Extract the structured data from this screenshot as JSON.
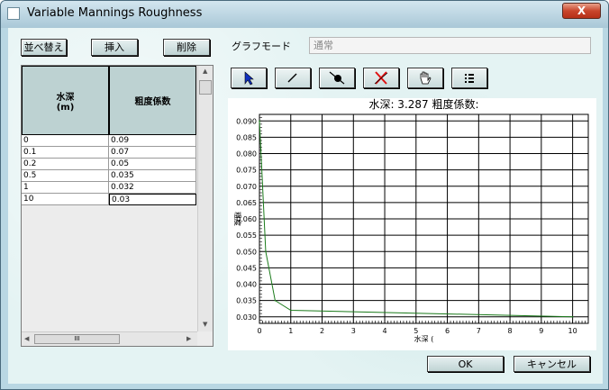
{
  "window": {
    "title": "Variable Mannings Roughness",
    "close_label": "X"
  },
  "toolbar": {
    "sort_label": "並べ替え",
    "insert_label": "挿入",
    "delete_label": "削除"
  },
  "graph_mode": {
    "label": "グラフモード",
    "value": "通常"
  },
  "grid": {
    "col1_line1": "水深",
    "col1_line2": "(m)",
    "col2": "粗度係数",
    "rows": [
      {
        "depth": "0",
        "coef": "0.09"
      },
      {
        "depth": "0.1",
        "coef": "0.07"
      },
      {
        "depth": "0.2",
        "coef": "0.05"
      },
      {
        "depth": "0.5",
        "coef": "0.035"
      },
      {
        "depth": "1",
        "coef": "0.032"
      },
      {
        "depth": "10",
        "coef": "0.03"
      }
    ],
    "hscroll_thumb": "III"
  },
  "tools": [
    "select-arrow-icon",
    "draw-line-icon",
    "delete-point-icon",
    "clear-x-icon",
    "pan-hand-icon",
    "list-icon"
  ],
  "chart_data": {
    "type": "line",
    "title": "水深: 3.287 粗度係数:",
    "xlabel": "水深 (",
    "ylabel": "粗度",
    "xlim": [
      0,
      10.5
    ],
    "ylim": [
      0.028,
      0.092
    ],
    "xticks": [
      "0",
      "1",
      "2",
      "3",
      "4",
      "5",
      "6",
      "7",
      "8",
      "9",
      "10"
    ],
    "yticks": [
      "0.030",
      "0.035",
      "0.040",
      "0.045",
      "0.050",
      "0.055",
      "0.060",
      "0.065",
      "0.070",
      "0.075",
      "0.080",
      "0.085",
      "0.090"
    ],
    "series": [
      {
        "color": "#1a7a1a",
        "x": [
          0,
          0.1,
          0.2,
          0.5,
          1,
          10
        ],
        "y": [
          0.09,
          0.07,
          0.05,
          0.035,
          0.032,
          0.03
        ]
      }
    ],
    "grid": true
  },
  "buttons": {
    "ok": "OK",
    "cancel": "キャンセル"
  }
}
